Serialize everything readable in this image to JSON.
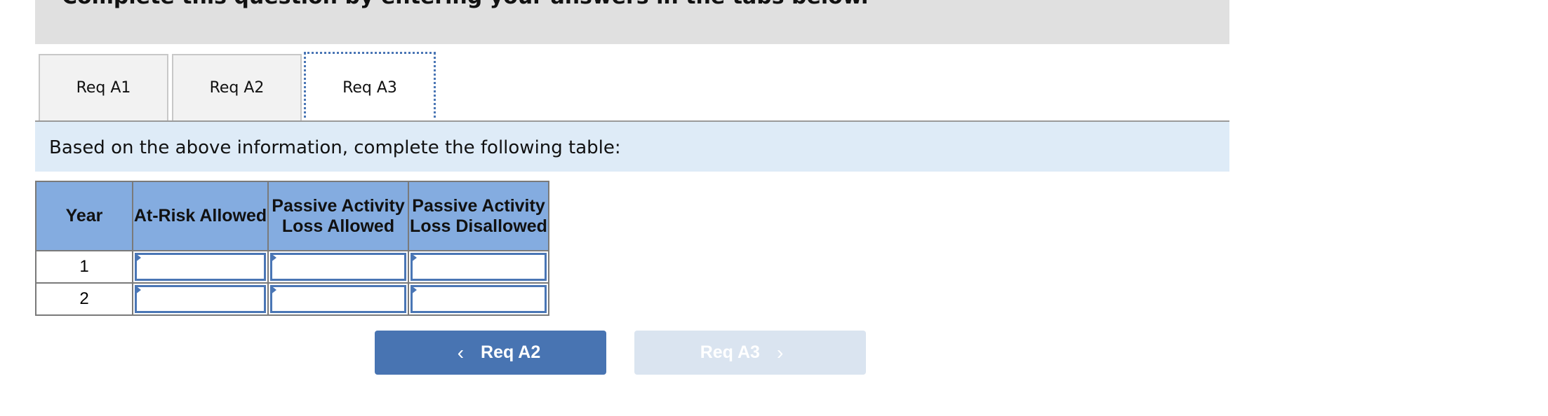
{
  "header": {
    "instruction": "Complete this question by entering your answers in the tabs below."
  },
  "tabs": [
    {
      "label": "Req A1"
    },
    {
      "label": "Req A2"
    },
    {
      "label": "Req A3",
      "active": true
    }
  ],
  "prompt": "Based on the above information, complete the following table:",
  "table": {
    "columns": [
      "Year",
      "At-Risk Allowed",
      "Passive Activity Loss Allowed",
      "Passive Activity Loss Disallowed"
    ],
    "rows": [
      {
        "year": "1",
        "values": [
          "",
          "",
          ""
        ]
      },
      {
        "year": "2",
        "values": [
          "",
          "",
          ""
        ]
      }
    ]
  },
  "nav": {
    "prev_label": "Req A2",
    "next_label": "Req A3",
    "prev_icon": "chevron-left-icon",
    "next_icon": "chevron-right-icon",
    "prev_glyph": "‹",
    "next_glyph": "›"
  },
  "colors": {
    "accent": "#4874b2",
    "header_fill": "#84ace0",
    "band": "#deebf7"
  }
}
